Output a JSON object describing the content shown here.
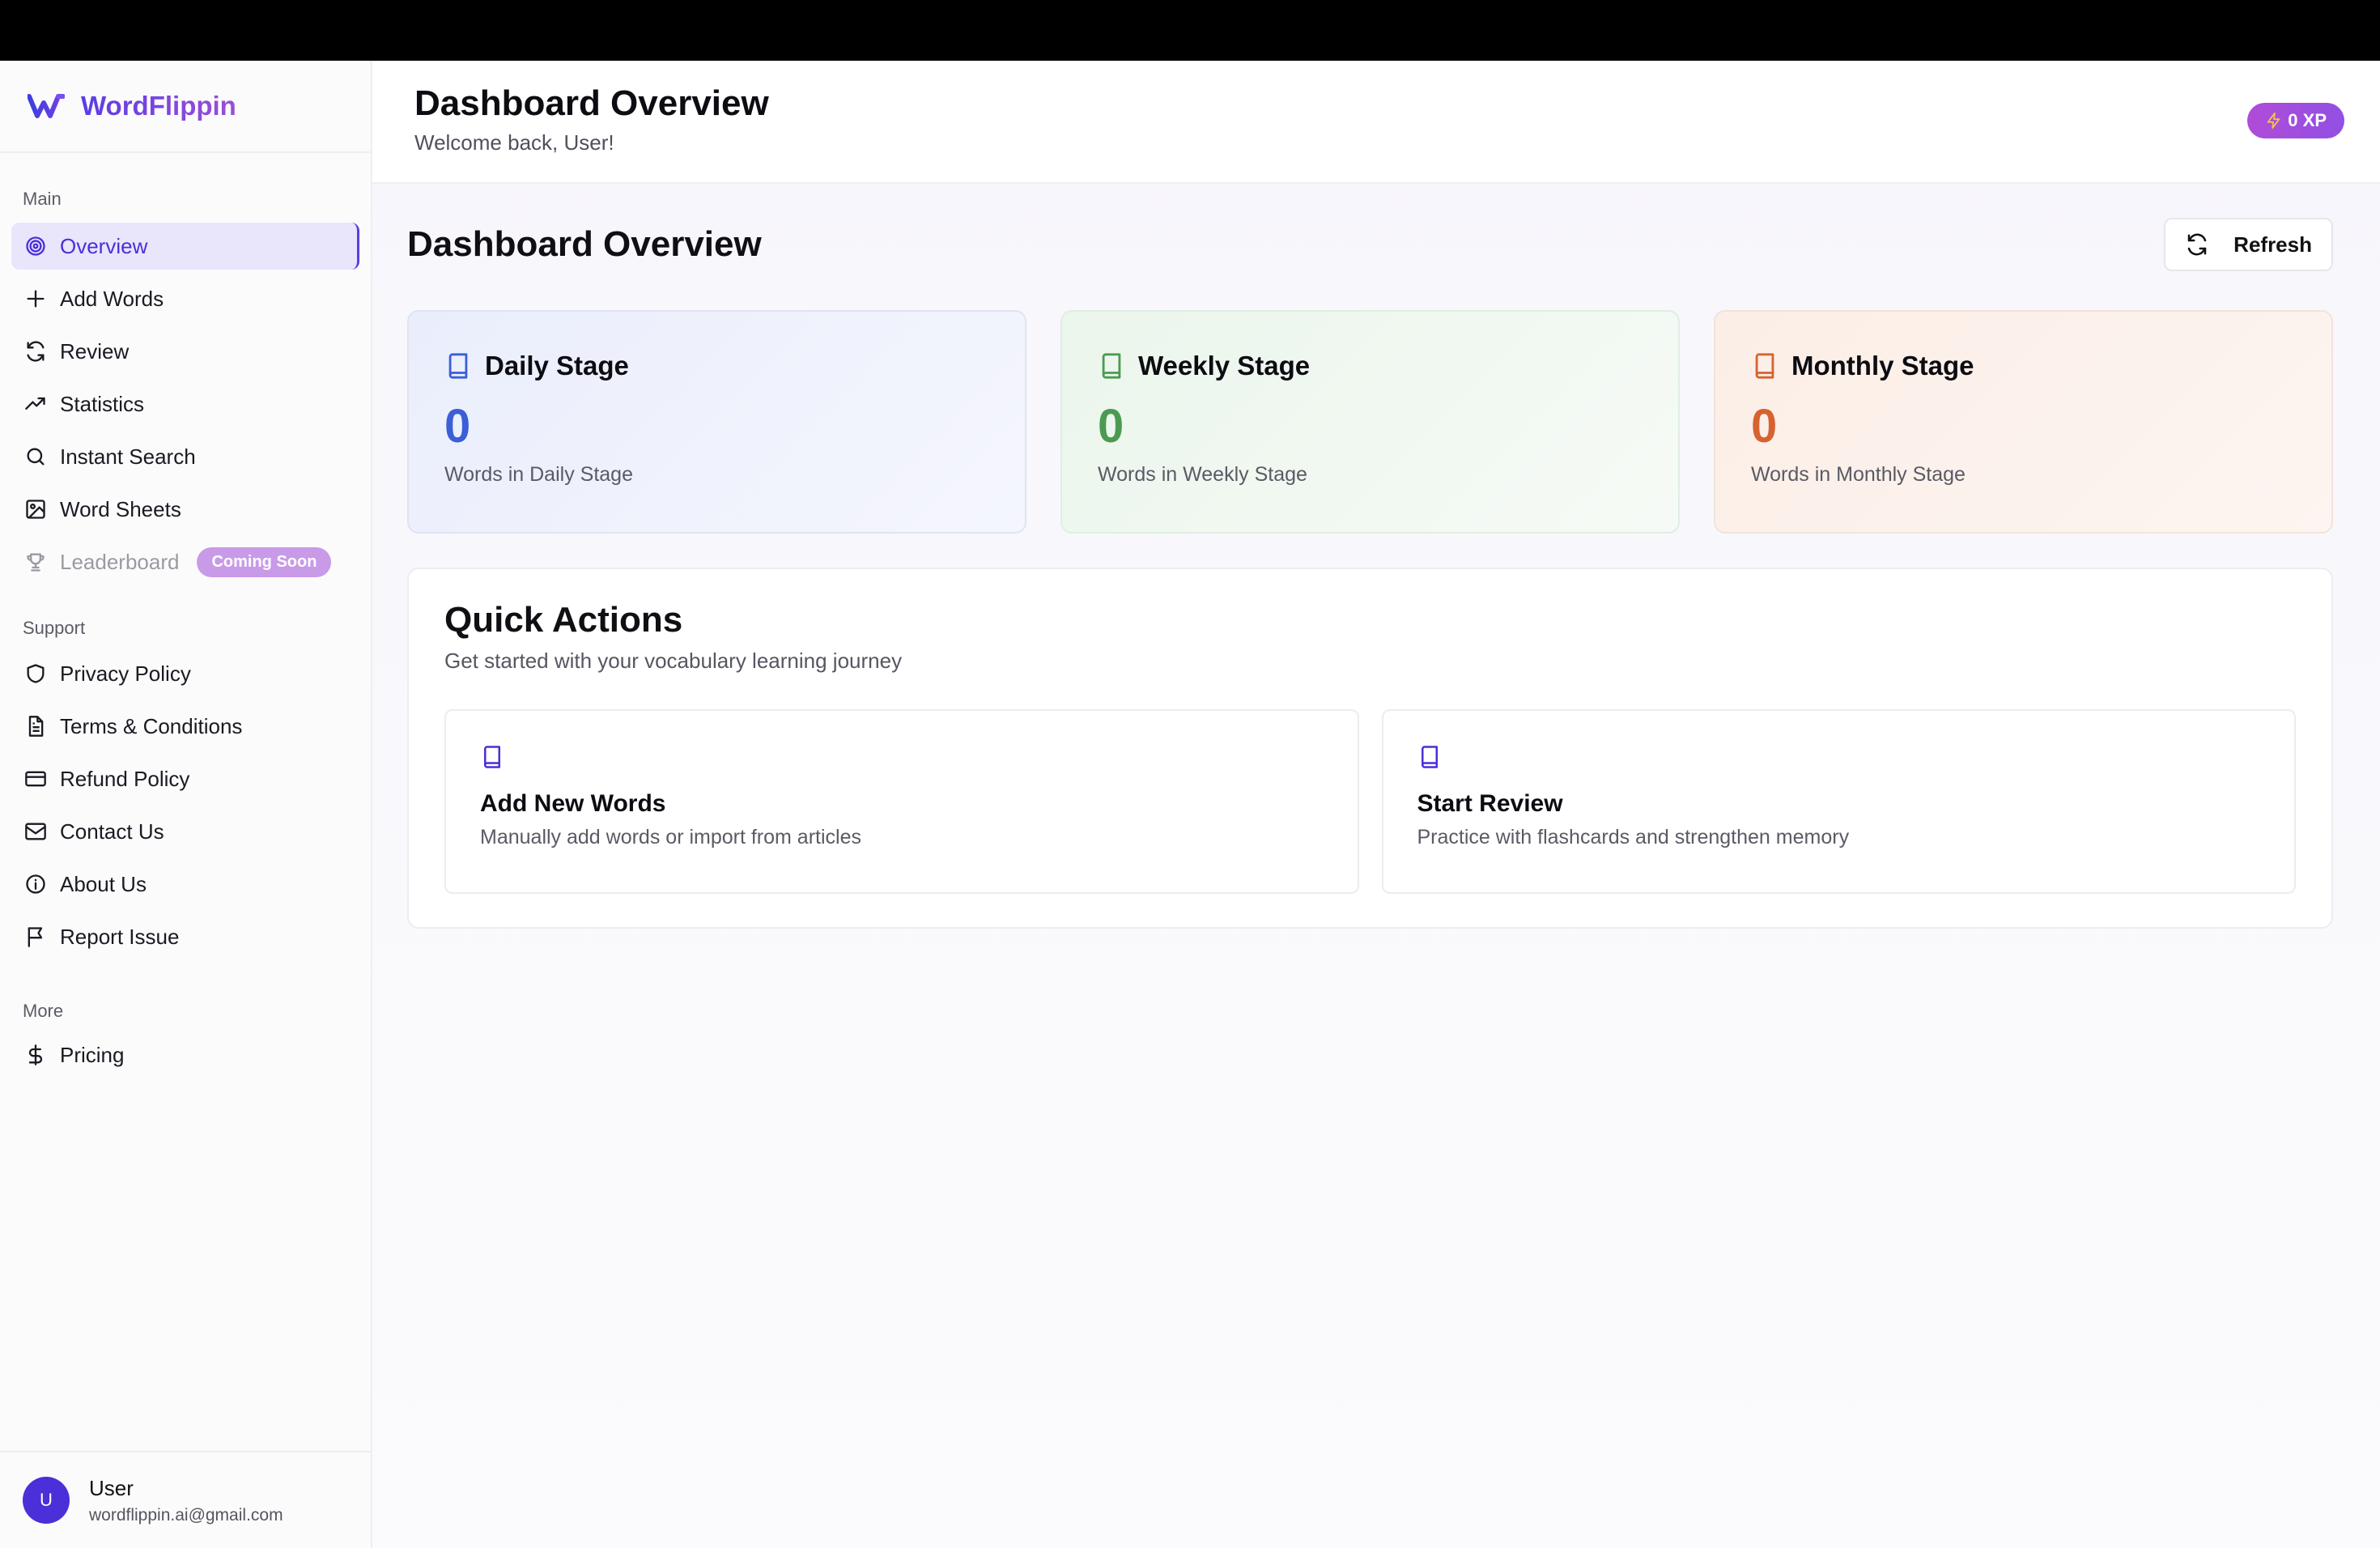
{
  "brand": {
    "name": "WordFlippin"
  },
  "sidebar": {
    "sections": {
      "main": "Main",
      "support": "Support",
      "more": "More"
    },
    "main_items": [
      {
        "label": "Overview",
        "icon": "target-icon"
      },
      {
        "label": "Add Words",
        "icon": "plus-icon"
      },
      {
        "label": "Review",
        "icon": "refresh-icon"
      },
      {
        "label": "Statistics",
        "icon": "trending-up-icon"
      },
      {
        "label": "Instant Search",
        "icon": "search-icon"
      },
      {
        "label": "Word Sheets",
        "icon": "image-icon"
      },
      {
        "label": "Leaderboard",
        "icon": "trophy-icon",
        "badge": "Coming Soon"
      }
    ],
    "support_items": [
      {
        "label": "Privacy Policy",
        "icon": "shield-icon"
      },
      {
        "label": "Terms & Conditions",
        "icon": "document-icon"
      },
      {
        "label": "Refund Policy",
        "icon": "credit-card-icon"
      },
      {
        "label": "Contact Us",
        "icon": "mail-icon"
      },
      {
        "label": "About Us",
        "icon": "info-icon"
      },
      {
        "label": "Report Issue",
        "icon": "flag-icon"
      }
    ],
    "more_items": [
      {
        "label": "Pricing",
        "icon": "dollar-icon"
      }
    ],
    "user": {
      "initial": "U",
      "name": "User",
      "email": "wordflippin.ai@gmail.com"
    }
  },
  "header": {
    "title": "Dashboard Overview",
    "subtitle": "Welcome back, User!",
    "xp": "0 XP"
  },
  "page": {
    "title": "Dashboard Overview",
    "refresh_label": "Refresh"
  },
  "stages": [
    {
      "title": "Daily Stage",
      "count": "0",
      "desc": "Words in Daily Stage",
      "color": "#3a5fd6"
    },
    {
      "title": "Weekly Stage",
      "count": "0",
      "desc": "Words in Weekly Stage",
      "color": "#4c9a52"
    },
    {
      "title": "Monthly Stage",
      "count": "0",
      "desc": "Words in Monthly Stage",
      "color": "#d6632f"
    }
  ],
  "quick_actions": {
    "title": "Quick Actions",
    "subtitle": "Get started with your vocabulary learning journey",
    "items": [
      {
        "title": "Add New Words",
        "desc": "Manually add words or import from articles",
        "icon": "book-icon"
      },
      {
        "title": "Start Review",
        "desc": "Practice with flashcards and strengthen memory",
        "icon": "book-icon"
      }
    ]
  },
  "colors": {
    "accent": "#5b3ce6",
    "xp_badge": "#a14fdd"
  }
}
